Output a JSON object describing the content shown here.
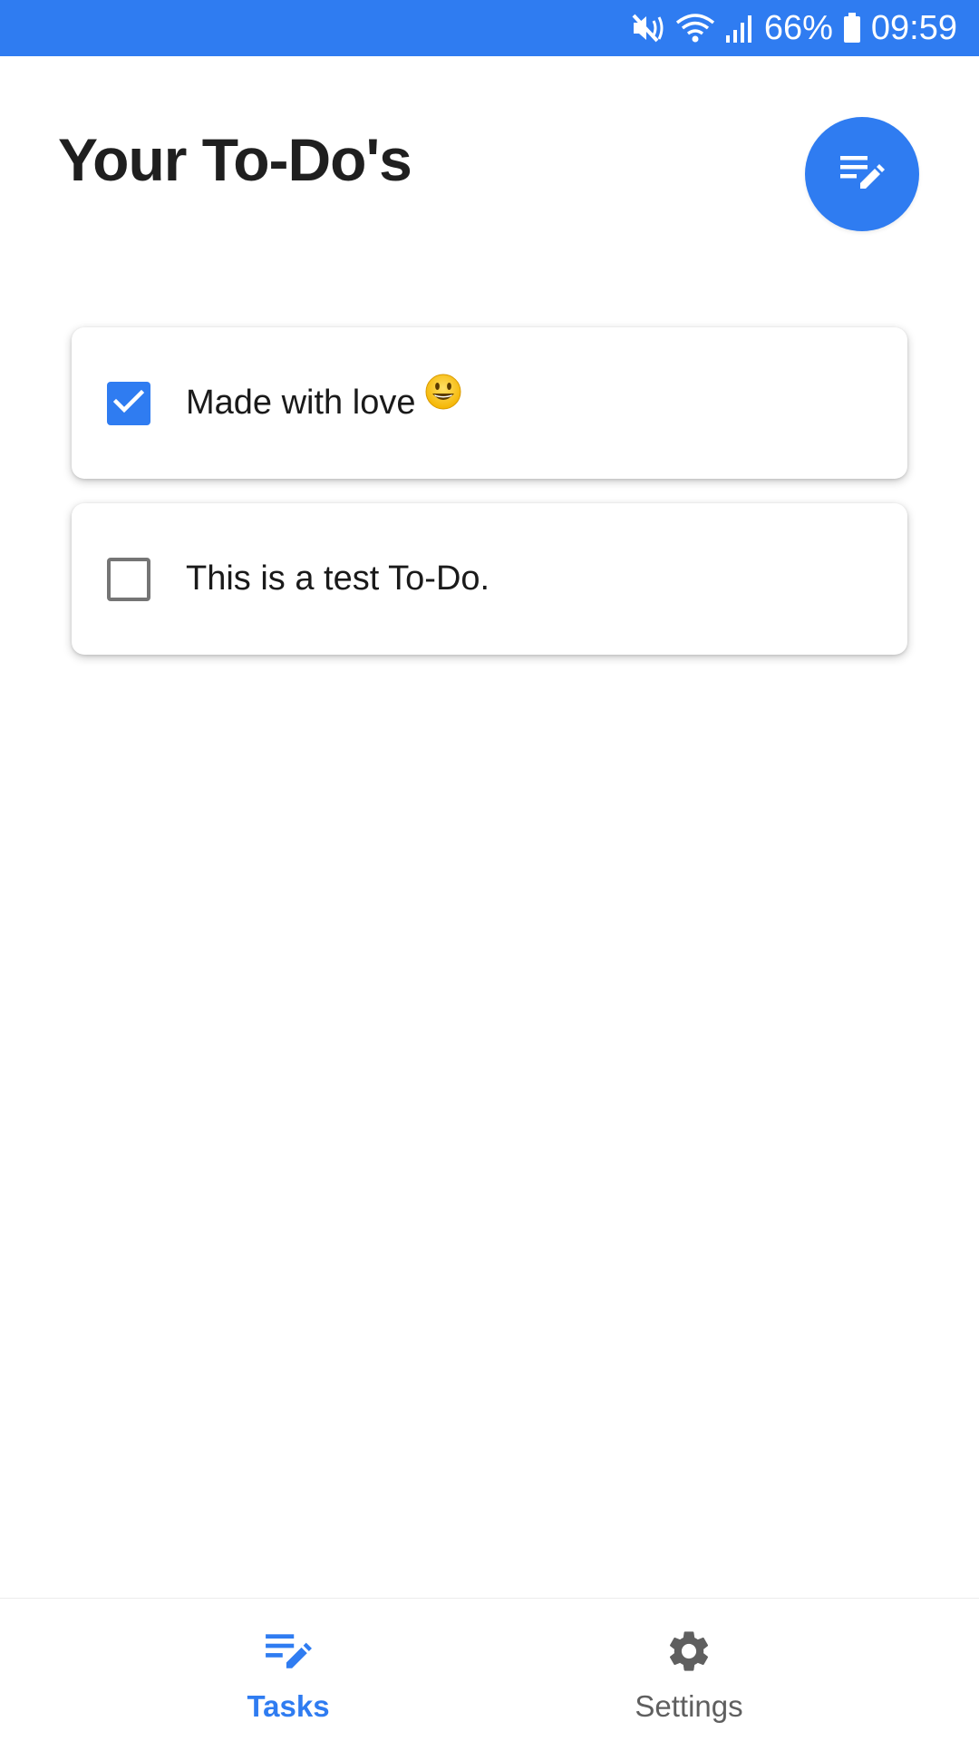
{
  "status_bar": {
    "battery_percent": "66%",
    "time": "09:59",
    "icons": [
      "mute-vibrate-icon",
      "wifi-icon",
      "signal-icon",
      "battery-icon"
    ]
  },
  "header": {
    "title": "Your To-Do's",
    "fab_icon": "edit-note-icon"
  },
  "todos": [
    {
      "text": "Made with love",
      "emoji": "😃",
      "checked": true
    },
    {
      "text": "This is a test To-Do.",
      "checked": false
    }
  ],
  "bottom_nav": {
    "items": [
      {
        "label": "Tasks",
        "icon": "edit-note-icon",
        "active": true
      },
      {
        "label": "Settings",
        "icon": "gear-icon",
        "active": false
      }
    ]
  },
  "colors": {
    "accent": "#2f7cf1",
    "inactive": "#5f5f5f",
    "text": "#1f1f1f"
  }
}
